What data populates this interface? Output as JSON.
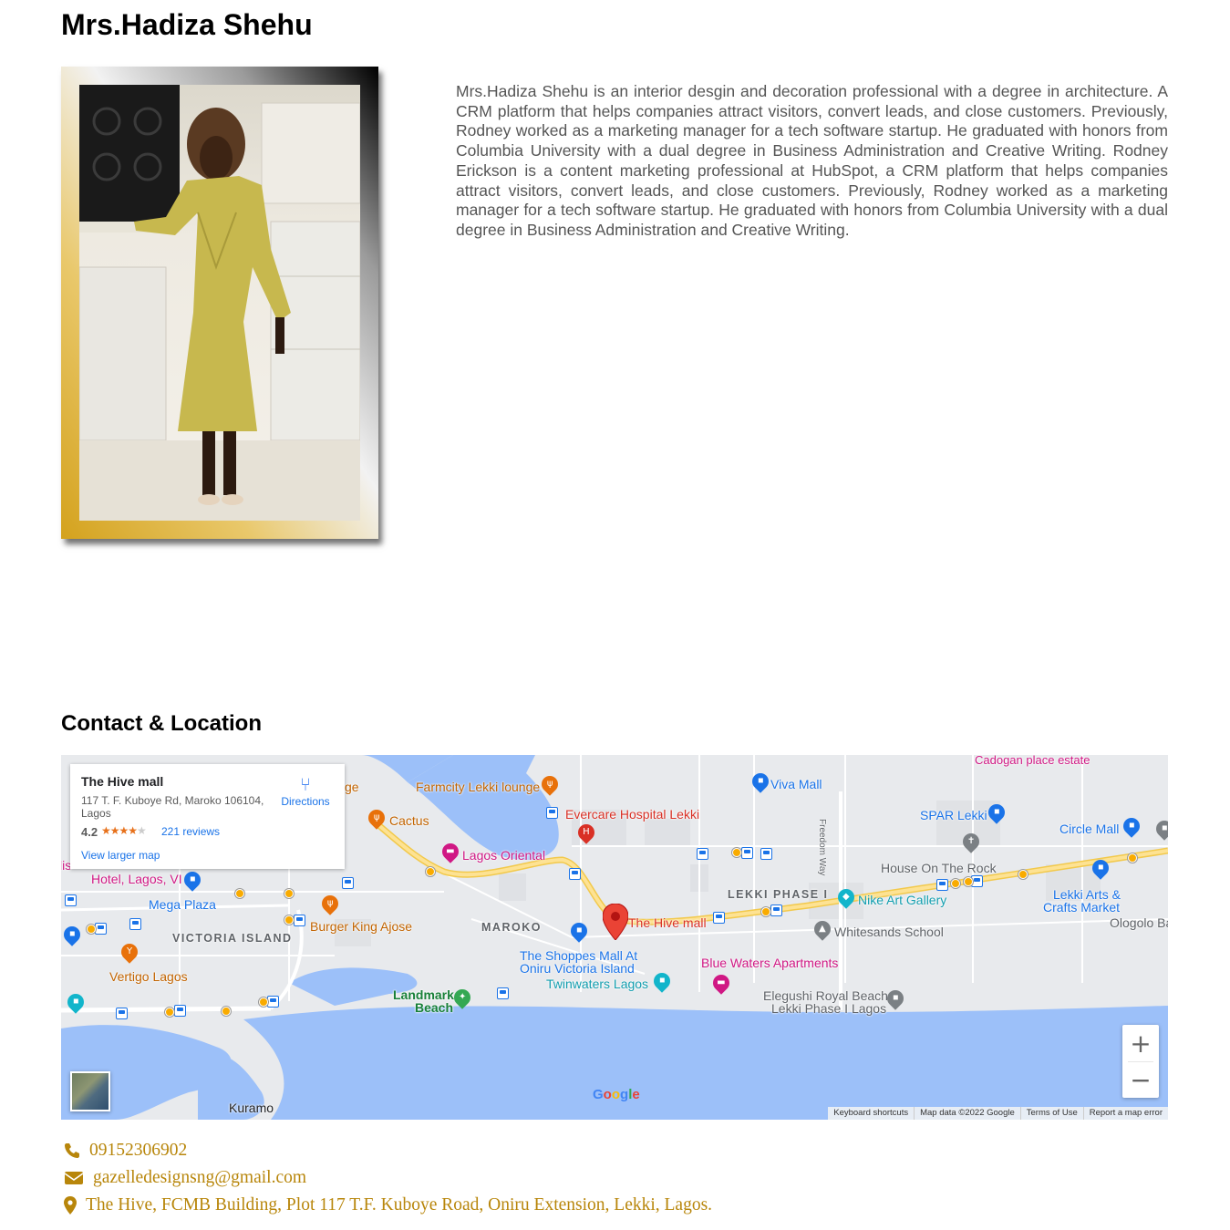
{
  "profile": {
    "name": "Mrs.Hadiza Shehu",
    "bio": "Mrs.Hadiza Shehu is an interior desgin and decoration professional with a degree in architecture. A CRM platform that helps companies attract visitors, convert leads, and close customers. Previously, Rodney worked as a marketing manager for a tech software startup. He graduated with honors from Columbia University with a dual degree in Business Administration and Creative Writing. Rodney Erickson is a content marketing professional at HubSpot, a CRM platform that helps companies attract visitors, convert leads, and close customers. Previously, Rodney worked as a marketing manager for a tech software startup. He graduated with honors from Columbia University with a dual degree in Business Administration and Creative Writing."
  },
  "contact_section": {
    "title": "Contact & Location"
  },
  "map": {
    "place_card": {
      "name": "The Hive mall",
      "address": "117 T. F. Kuboye Rd, Maroko 106104, Lagos",
      "rating": "4.2",
      "stars": "★★★★",
      "star_empty": "★",
      "reviews": "221 reviews",
      "view_larger": "View larger map",
      "directions": "Directions"
    },
    "labels": {
      "cadogan": "Cadogan place estate",
      "viva": "Viva Mall",
      "farmcity": "Farmcity Lekki lounge",
      "evercare": "Evercare Hospital Lekki",
      "spar": "SPAR Lekki",
      "circle": "Circle Mall",
      "cactus": "Cactus",
      "lagos_oriental": "Lagos Oriental",
      "house_rock": "House On The Rock",
      "hotel": "Hotel, Lagos, VI",
      "lekki_phase": "LEKKI PHASE I",
      "nike": "Nike Art Gallery",
      "lekki_arts_1": "Lekki Arts &",
      "lekki_arts_2": "Crafts Market",
      "mega": "Mega Plaza",
      "hive": "The Hive mall",
      "burger": "Burger King Ajose",
      "maroko": "MAROKO",
      "whitesands": "Whitesands School",
      "ologolo": "Ologolo Ba",
      "victoria": "VICTORIA ISLAND",
      "shoppes_1": "The Shoppes Mall At",
      "shoppes_2": "Oniru Victoria Island",
      "blue_waters": "Blue Waters Apartments",
      "vertigo": "Vertigo Lagos",
      "twinwaters": "Twinwaters Lagos",
      "landmark_1": "Landmark",
      "landmark_2": "Beach",
      "elegushi_1": "Elegushi Royal Beach",
      "elegushi_2": "Lekki Phase I Lagos",
      "freedom": "Freedom Way",
      "kuramo": "Kuramo",
      "ge": "ge",
      "lis": "lis"
    },
    "zoom_in": "+",
    "zoom_out": "−",
    "google": [
      "G",
      "o",
      "o",
      "g",
      "l",
      "e"
    ],
    "google_colors": [
      "#4285f4",
      "#ea4335",
      "#fbbc05",
      "#4285f4",
      "#34a853",
      "#ea4335"
    ],
    "attribution": [
      "Keyboard shortcuts",
      "Map data ©2022 Google",
      "Terms of Use",
      "Report a map error"
    ]
  },
  "contacts": {
    "phone": "09152306902",
    "email": "gazelledesignsng@gmail.com",
    "address": "The Hive, FCMB Building, Plot 117 T.F. Kuboye Road, Oniru Extension, Lekki, Lagos."
  },
  "colors": {
    "accent_gold": "#b8860b",
    "water": "#9cc0f9",
    "road_major": "#fdd866",
    "marker_red": "#ea4335"
  },
  "icons": {
    "phone": "phone-icon",
    "email": "envelope-icon",
    "address": "map-marker-icon"
  }
}
